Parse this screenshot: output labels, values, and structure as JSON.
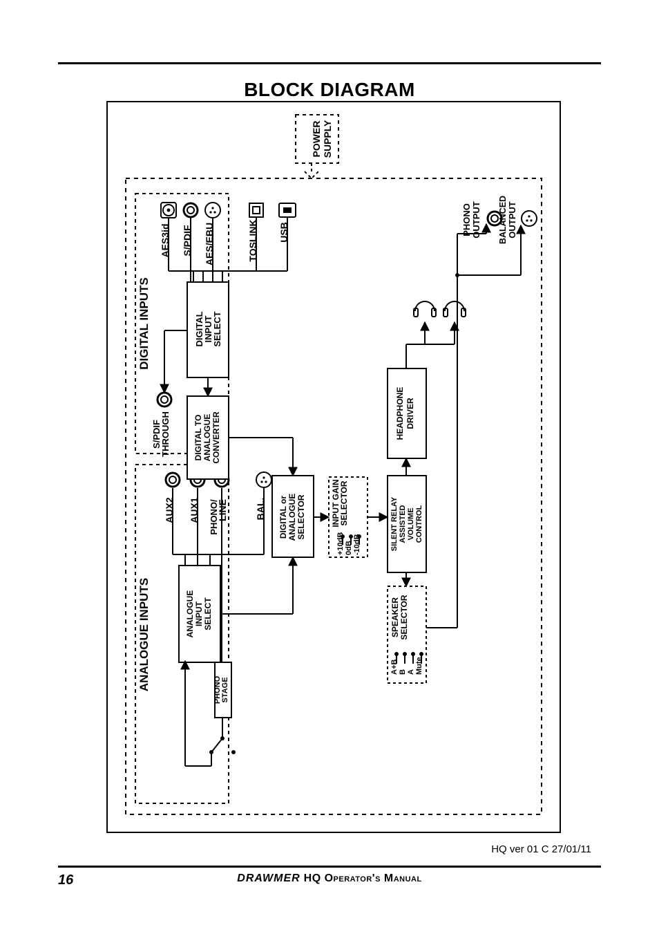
{
  "title": "BLOCK DIAGRAM",
  "footer": {
    "version": "HQ ver 01  C  27/01/11",
    "page": "16",
    "brand": "DRAWMER",
    "manual": " HQ Operator's Manual"
  },
  "power_supply": {
    "l1": "POWER",
    "l2": "SUPPLY"
  },
  "digital_inputs": {
    "heading": "DIGITAL INPUTS",
    "items": [
      "AES3id",
      "S/PDIF",
      "AES/EBU",
      "TOSLINK",
      "USB"
    ]
  },
  "analogue_inputs": {
    "heading": "ANALOGUE INPUTS",
    "items": [
      "AUX2",
      "AUX1",
      "PHONO/",
      "LINE",
      "BAL."
    ]
  },
  "top_out": {
    "spdif1": "S/PDIF",
    "spdif2": "THROUGH"
  },
  "blocks": {
    "dig_in_sel": {
      "l1": "DIGITAL",
      "l2": "INPUT",
      "l3": "SELECT"
    },
    "dac": {
      "l1": "DIGITAL TO",
      "l2": "ANALOGUE",
      "l3": "CONVERTER"
    },
    "da_sel": {
      "l1": "DIGITAL or",
      "l2": "ANALOGUE",
      "l3": "SELECTOR"
    },
    "ana_in_sel": {
      "l1": "ANALOGUE",
      "l2": "INPUT",
      "l3": "SELECT"
    },
    "phono_stage": {
      "l1": "PHONO",
      "l2": "STAGE"
    },
    "gain": {
      "title1": "INPUT GAIN",
      "title2": "SELECTOR",
      "o1": "+10dB",
      "o2": "0dB",
      "o3": "-10dB"
    },
    "hp": {
      "l1": "HEADPHONE",
      "l2": "DRIVER"
    },
    "vol": {
      "l1": "SILENT RELAY",
      "l2": "ASSISTED",
      "l3": "VOLUME",
      "l4": "CONTROL"
    },
    "spk": {
      "title1": "SPEAKER",
      "title2": "SELECTOR",
      "o1": "A+B",
      "o2": "B",
      "o3": "A",
      "o4": "Mute"
    }
  },
  "outputs": {
    "phono": {
      "l1": "PHONO",
      "l2": "OUTPUT"
    },
    "bal": {
      "l1": "BALANCED",
      "l2": "OUTPUT"
    }
  }
}
